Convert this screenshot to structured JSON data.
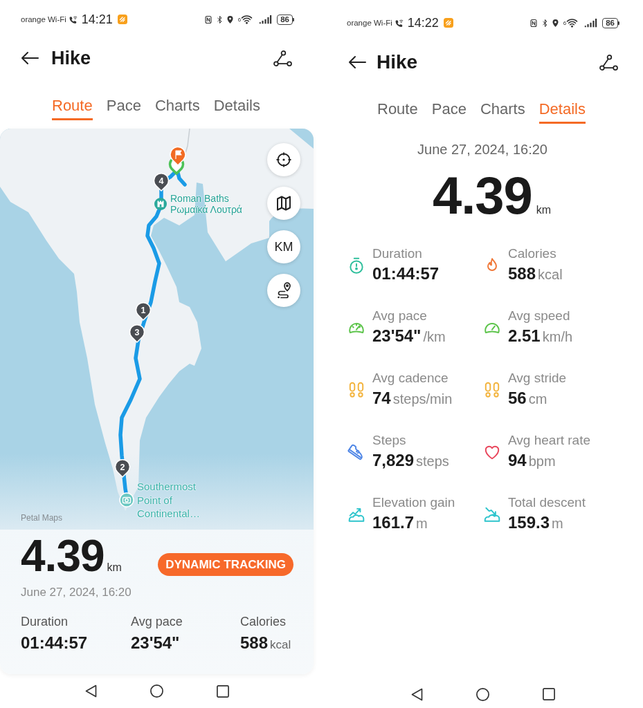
{
  "screens": [
    {
      "kind": "route",
      "status_bar": {
        "carrier": "orange Wi-Fi",
        "time": "14:21",
        "network_type": "6",
        "battery": "86"
      },
      "header": {
        "title": "Hike"
      },
      "tabs": [
        {
          "label": "Route",
          "selected": true
        },
        {
          "label": "Pace",
          "selected": false
        },
        {
          "label": "Charts",
          "selected": false
        },
        {
          "label": "Details",
          "selected": false
        }
      ],
      "map": {
        "controls": [
          {
            "kind": "locate"
          },
          {
            "kind": "layers"
          },
          {
            "kind": "units",
            "label": "KM"
          },
          {
            "kind": "route"
          }
        ],
        "markers": [
          {
            "label": "4"
          },
          {
            "label": "1"
          },
          {
            "label": "3"
          },
          {
            "label": "2"
          }
        ],
        "places": [
          {
            "kind": "landmark",
            "name": "Roman Baths",
            "local_name": "Ρωμαϊκά Λουτρά"
          },
          {
            "kind": "viewpoint",
            "name": "Southermost Point of Continental…"
          }
        ],
        "attribution": "Petal Maps"
      },
      "summary": {
        "distance": "4.39",
        "unit": "km",
        "badge": "DYNAMIC TRACKING",
        "date": "June 27, 2024, 16:20",
        "stats": [
          {
            "label": "Duration",
            "value": "01:44:57"
          },
          {
            "label": "Avg pace",
            "value": "23'54\""
          },
          {
            "label": "Calories",
            "value": "588",
            "unit": "kcal"
          }
        ]
      }
    },
    {
      "kind": "details",
      "status_bar": {
        "carrier": "orange Wi-Fi",
        "time": "14:22",
        "network_type": "6",
        "battery": "86"
      },
      "header": {
        "title": "Hike"
      },
      "tabs": [
        {
          "label": "Route",
          "selected": false
        },
        {
          "label": "Pace",
          "selected": false
        },
        {
          "label": "Charts",
          "selected": false
        },
        {
          "label": "Details",
          "selected": true
        }
      ],
      "date": "June 27, 2024, 16:20",
      "distance": "4.39",
      "unit": "km",
      "metrics": [
        {
          "kind": "duration",
          "label": "Duration",
          "value": "01:44:57"
        },
        {
          "kind": "calories",
          "label": "Calories",
          "value": "588",
          "unit": "kcal"
        },
        {
          "kind": "pace",
          "label": "Avg pace",
          "value": "23'54\"",
          "unit": "/km"
        },
        {
          "kind": "speed",
          "label": "Avg speed",
          "value": "2.51",
          "unit": "km/h"
        },
        {
          "kind": "cadence",
          "label": "Avg cadence",
          "value": "74",
          "unit": "steps/min"
        },
        {
          "kind": "stride",
          "label": "Avg stride",
          "value": "56",
          "unit": "cm"
        },
        {
          "kind": "steps",
          "label": "Steps",
          "value": "7,829",
          "unit": "steps"
        },
        {
          "kind": "heart_rate",
          "label": "Avg heart rate",
          "value": "94",
          "unit": "bpm"
        },
        {
          "kind": "elevation_gain",
          "label": "Elevation gain",
          "value": "161.7",
          "unit": "m"
        },
        {
          "kind": "descent",
          "label": "Total descent",
          "value": "159.3",
          "unit": "m"
        }
      ]
    }
  ]
}
